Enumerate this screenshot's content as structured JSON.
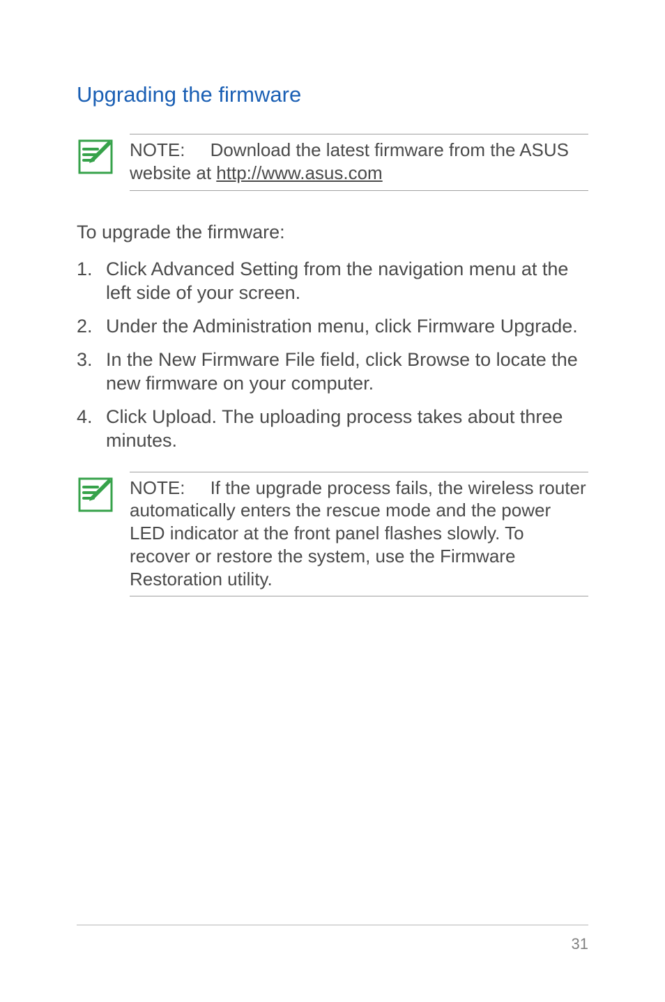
{
  "heading": "Upgrading the firmware",
  "note1": {
    "prefix": "NOTE:",
    "text_before_link": "     Download the latest firmware from the ASUS website at ",
    "link": "http://www.asus.com"
  },
  "intro": "To upgrade the firmware:",
  "steps": [
    "Click Advanced Setting from the navigation menu at the left side of your screen.",
    "Under the Administration menu, click Firmware Upgrade.",
    "In the New Firmware File field, click Browse to locate the new firmware on your computer.",
    "Click Upload. The uploading process takes about three minutes."
  ],
  "note2": {
    "prefix": "NOTE:",
    "text": "     If the upgrade process fails, the wireless router automatically enters the rescue mode and the power LED indicator at the front panel flashes slowly. To recover or restore the system, use the Firmware Restoration utility."
  },
  "page_number": "31"
}
